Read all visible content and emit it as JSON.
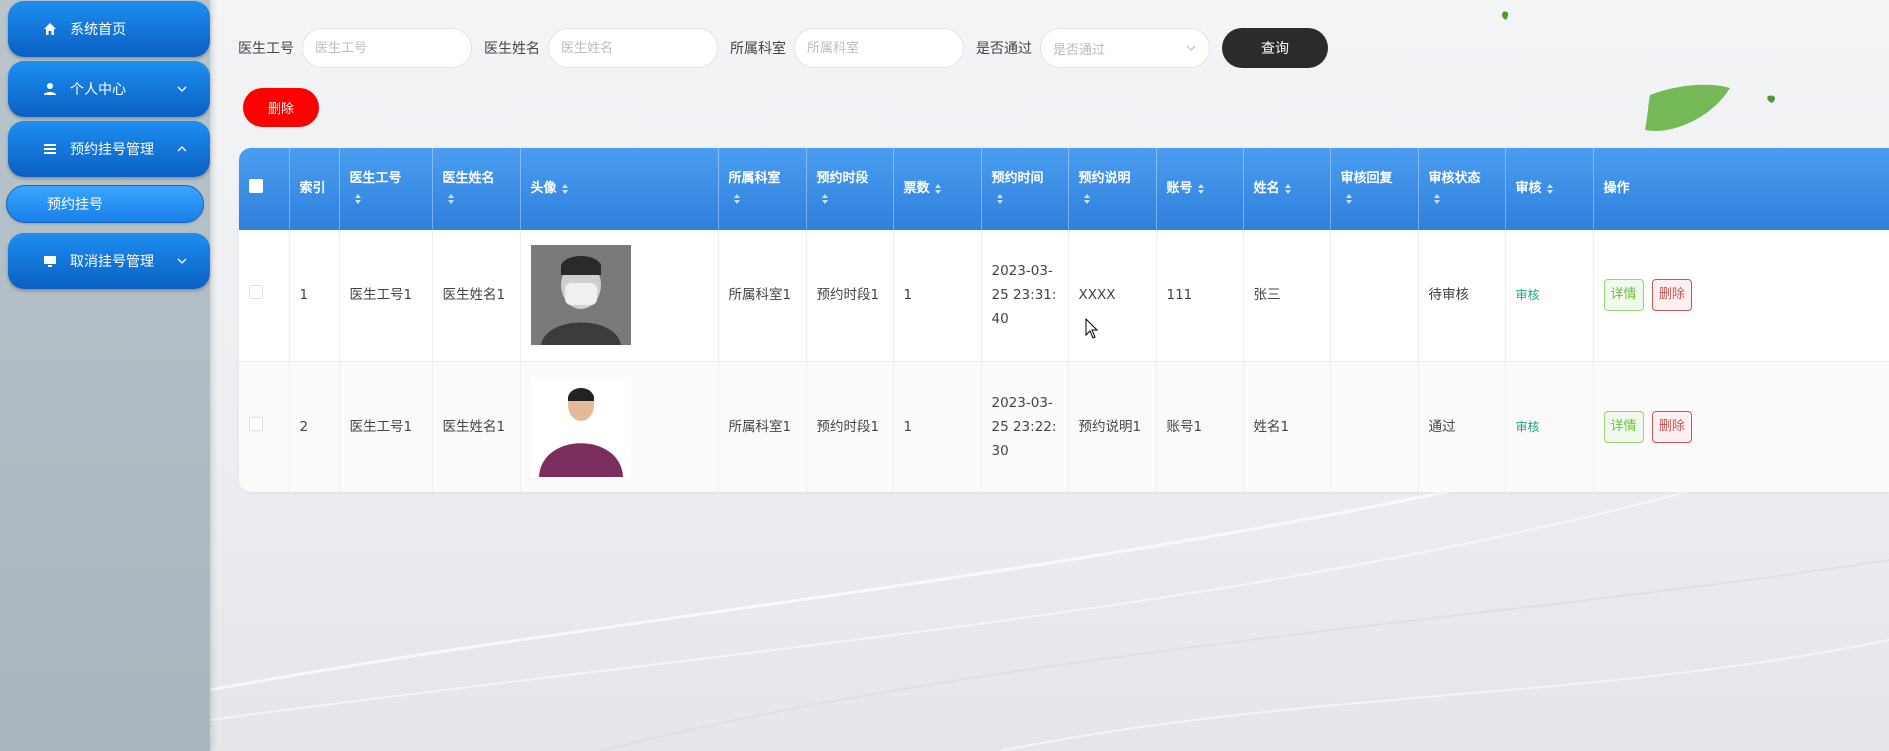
{
  "sidebar": {
    "items": [
      {
        "label": "系统首页",
        "icon": "home-icon"
      },
      {
        "label": "个人中心",
        "icon": "user-icon"
      },
      {
        "label": "预约挂号管理",
        "icon": "list-icon"
      },
      {
        "label": "取消挂号管理",
        "icon": "monitor-icon"
      }
    ],
    "subitem": {
      "label": "预约挂号"
    }
  },
  "search": {
    "doctor_id_label": "医生工号",
    "doctor_id_placeholder": "医生工号",
    "doctor_name_label": "医生姓名",
    "doctor_name_placeholder": "医生姓名",
    "department_label": "所属科室",
    "department_placeholder": "所属科室",
    "passed_label": "是否通过",
    "passed_placeholder": "是否通过",
    "query_label": "查询"
  },
  "toolbar": {
    "delete_label": "删除"
  },
  "table": {
    "columns": [
      "索引",
      "医生工号",
      "医生姓名",
      "头像",
      "所属科室",
      "预约时段",
      "票数",
      "预约时间",
      "预约说明",
      "账号",
      "姓名",
      "审核回复",
      "审核状态",
      "审核",
      "操作"
    ],
    "rows": [
      {
        "index": "1",
        "doctor_id": "医生工号1",
        "doctor_name": "医生姓名1",
        "department": "所属科室1",
        "period": "预约时段1",
        "tickets": "1",
        "time": "2023-03-25 23:31:40",
        "note": "XXXX",
        "account": "111",
        "name": "张三",
        "reply": "",
        "status": "待审核",
        "audit": "审核",
        "detail": "详情",
        "delete": "删除"
      },
      {
        "index": "2",
        "doctor_id": "医生工号1",
        "doctor_name": "医生姓名1",
        "department": "所属科室1",
        "period": "预约时段1",
        "tickets": "1",
        "time": "2023-03-25 23:22:30",
        "note": "预约说明1",
        "account": "账号1",
        "name": "姓名1",
        "reply": "",
        "status": "通过",
        "audit": "审核",
        "detail": "详情",
        "delete": "删除"
      }
    ]
  },
  "colors": {
    "menu_blue": "#0b5fc4",
    "header_blue": "#3d8fe8",
    "delete_red": "#ff0000",
    "query_dark": "#2b2b2b",
    "audit_green": "#1aa88a"
  }
}
